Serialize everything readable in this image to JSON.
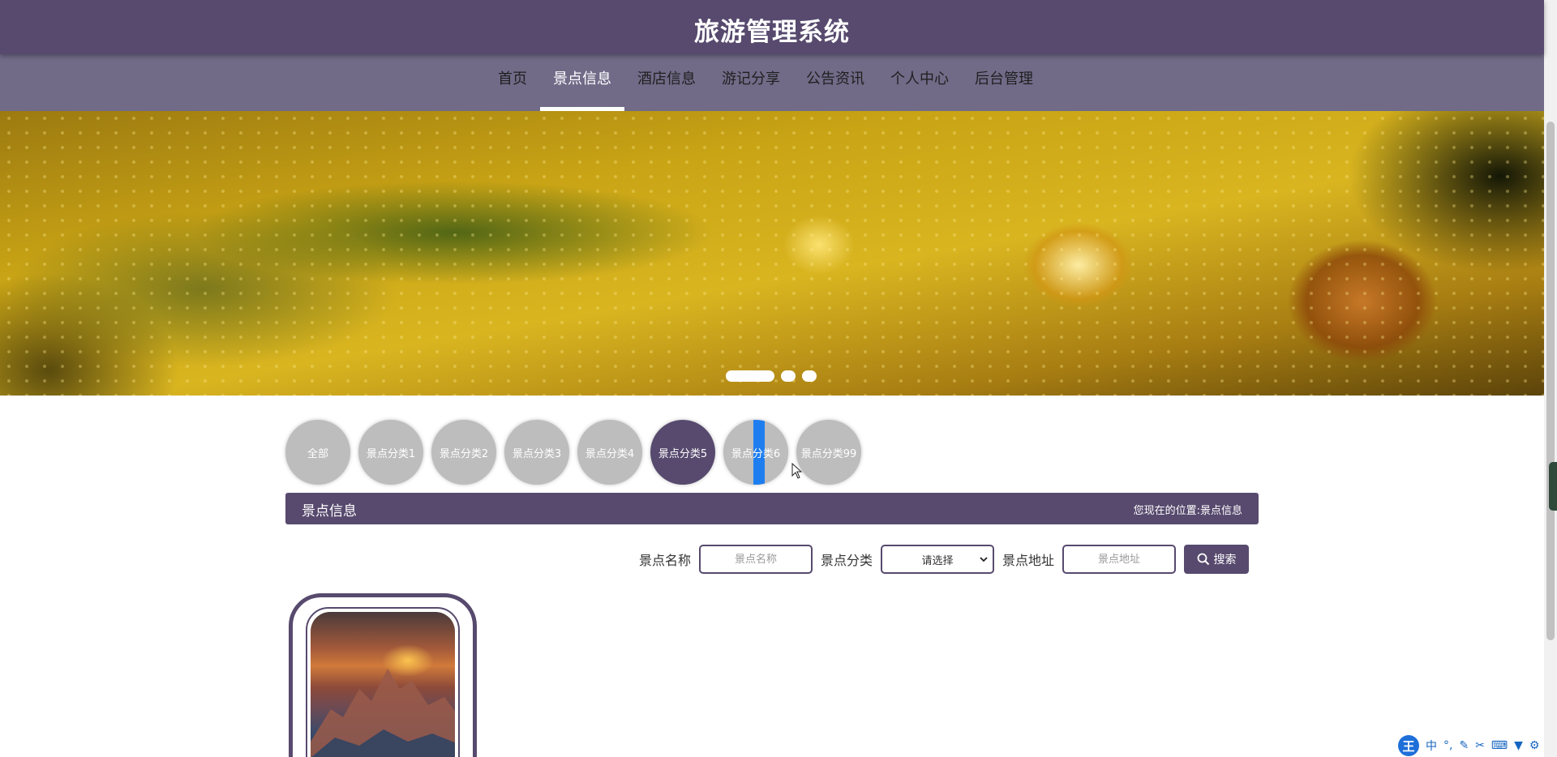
{
  "header": {
    "title": "旅游管理系统"
  },
  "nav": {
    "items": [
      {
        "label": "首页"
      },
      {
        "label": "景点信息"
      },
      {
        "label": "酒店信息"
      },
      {
        "label": "游记分享"
      },
      {
        "label": "公告资讯"
      },
      {
        "label": "个人中心"
      },
      {
        "label": "后台管理"
      }
    ],
    "active_index": 1
  },
  "banner": {
    "slide_count": 3,
    "active_slide": 1
  },
  "categories": {
    "items": [
      {
        "label": "全部"
      },
      {
        "label": "景点分类1"
      },
      {
        "label": "景点分类2"
      },
      {
        "label": "景点分类3"
      },
      {
        "label": "景点分类4"
      },
      {
        "label": "景点分类5"
      },
      {
        "label": "景点分类6"
      },
      {
        "label": "景点分类99"
      }
    ],
    "active_index": 5
  },
  "section": {
    "title": "景点信息",
    "location_label": "您现在的位置:",
    "location_value": "景点信息"
  },
  "search": {
    "name_label": "景点名称",
    "name_placeholder": "景点名称",
    "category_label": "景点分类",
    "category_selected": "请选择",
    "address_label": "景点地址",
    "address_placeholder": "景点地址",
    "button_label": "搜索"
  },
  "ime": {
    "logo": "王",
    "mode": "中"
  },
  "colors": {
    "primary": "#574a6e",
    "nav_bg": "#716b88",
    "category_inactive": "#bdbdbd",
    "selection": "#1e7ef0"
  }
}
